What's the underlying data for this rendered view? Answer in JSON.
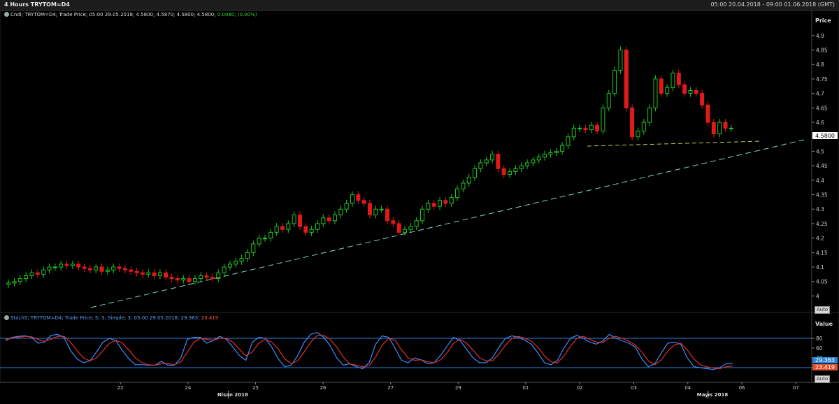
{
  "header": {
    "title": "4 Hours TRYTOM=D4",
    "range": "05:00 20.04.2018 - 09:00 01.06.2018 (GMT)"
  },
  "price_legend": {
    "text": "Cndl; TRYTOM=D4; Trade Price; 05:00 29.05.2018; 4.5800; 4.5870; 4.5800; 4.5800;",
    "change": "0.0080; (0.00%)"
  },
  "stoch_legend": {
    "text": "Stoch5; TRYTOM=D4; Trade Price;  5; 3; Simple; 3; 05:00 29.05.2018;",
    "k": "29.363;",
    "d": "23.419"
  },
  "auto_label": "Auto",
  "colors": {
    "up": "#1fc81f",
    "down": "#e01a1a",
    "stoch_k": "#3d8bff",
    "stoch_d": "#e0302a",
    "trend": "#7fd6c8",
    "support": "#c8c85a",
    "ref_lines": "#2a7fd6",
    "price_box_bg": "#ffffff",
    "k_box_bg": "#2a86d6",
    "d_box_bg": "#e0502a"
  },
  "chart_data": [
    {
      "type": "candlestick",
      "ylabel": "Price",
      "ylim": [
        3.96,
        4.96
      ],
      "y_ticks": [
        4,
        4.05,
        4.1,
        4.15,
        4.2,
        4.25,
        4.3,
        4.35,
        4.4,
        4.45,
        4.5,
        4.55,
        4.6,
        4.65,
        4.7,
        4.75,
        4.8,
        4.85,
        4.9
      ],
      "last_price": "4.5800",
      "last_value": 4.58,
      "closes": [
        4.045,
        4.05,
        4.06,
        4.07,
        4.08,
        4.075,
        4.09,
        4.1,
        4.1,
        4.11,
        4.105,
        4.11,
        4.1,
        4.095,
        4.09,
        4.1,
        4.085,
        4.09,
        4.1,
        4.095,
        4.09,
        4.085,
        4.08,
        4.075,
        4.08,
        4.07,
        4.08,
        4.065,
        4.06,
        4.055,
        4.06,
        4.05,
        4.06,
        4.07,
        4.065,
        4.06,
        4.08,
        4.1,
        4.11,
        4.12,
        4.13,
        4.15,
        4.18,
        4.2,
        4.2,
        4.22,
        4.24,
        4.23,
        4.25,
        4.28,
        4.24,
        4.22,
        4.23,
        4.25,
        4.27,
        4.26,
        4.28,
        4.3,
        4.32,
        4.35,
        4.33,
        4.32,
        4.28,
        4.3,
        4.3,
        4.26,
        4.25,
        4.22,
        4.23,
        4.24,
        4.26,
        4.3,
        4.32,
        4.31,
        4.33,
        4.32,
        4.34,
        4.37,
        4.39,
        4.41,
        4.44,
        4.46,
        4.47,
        4.49,
        4.44,
        4.42,
        4.43,
        4.44,
        4.45,
        4.46,
        4.47,
        4.48,
        4.49,
        4.495,
        4.5,
        4.52,
        4.55,
        4.58,
        4.58,
        4.575,
        4.59,
        4.57,
        4.65,
        4.7,
        4.78,
        4.85,
        4.65,
        4.55,
        4.57,
        4.6,
        4.65,
        4.75,
        4.7,
        4.72,
        4.77,
        4.73,
        4.7,
        4.71,
        4.7,
        4.66,
        4.6,
        4.56,
        4.6,
        4.58,
        4.58
      ],
      "x_range": [
        20.2,
        32.0
      ],
      "x_ticks": [
        {
          "label": "22",
          "x": 21.9
        },
        {
          "label": "24",
          "x": 22.9
        },
        {
          "label": "25",
          "x": 23.9
        },
        {
          "label": "26",
          "x": 24.9
        },
        {
          "label": "27",
          "x": 25.9
        },
        {
          "label": "29",
          "x": 26.9
        },
        {
          "label": "01",
          "x": 27.9
        },
        {
          "label": "02",
          "x": 28.7
        },
        {
          "label": "03",
          "x": 29.5
        },
        {
          "label": "04",
          "x": 30.3
        },
        {
          "label": "06",
          "x": 31.1
        },
        {
          "label": "07",
          "x": 31.9
        }
      ],
      "months": [
        {
          "label": "Nisan 2018",
          "x": 23.5
        },
        {
          "label": "Mayıs 2018",
          "x": 30.6
        }
      ]
    },
    {
      "type": "line",
      "ylabel": "Value",
      "ylim": [
        0,
        100
      ],
      "y_ticks": [
        20,
        40,
        60,
        80
      ],
      "ref_levels": [
        80,
        20
      ],
      "series": [
        {
          "name": "K",
          "values": [
            75,
            82,
            84,
            85,
            82,
            70,
            72,
            86,
            88,
            82,
            55,
            38,
            30,
            34,
            52,
            72,
            80,
            75,
            55,
            38,
            26,
            26,
            25,
            25,
            33,
            25,
            25,
            40,
            78,
            82,
            82,
            70,
            76,
            84,
            78,
            62,
            45,
            35,
            72,
            82,
            80,
            62,
            38,
            22,
            25,
            45,
            72,
            88,
            92,
            82,
            65,
            40,
            25,
            28,
            22,
            18,
            30,
            68,
            85,
            82,
            60,
            35,
            30,
            40,
            36,
            28,
            30,
            45,
            64,
            82,
            75,
            58,
            40,
            30,
            30,
            40,
            62,
            80,
            85,
            82,
            76,
            68,
            50,
            30,
            26,
            35,
            60,
            80,
            86,
            80,
            72,
            68,
            75,
            88,
            80,
            75,
            70,
            62,
            38,
            22,
            28,
            50,
            70,
            72,
            68,
            40,
            22,
            20,
            18,
            16,
            20,
            28,
            29.363
          ]
        },
        {
          "name": "D",
          "values": [
            78,
            80,
            82,
            84,
            83,
            78,
            74,
            78,
            84,
            84,
            72,
            55,
            40,
            34,
            40,
            55,
            70,
            76,
            70,
            56,
            40,
            30,
            26,
            25,
            28,
            28,
            26,
            32,
            52,
            72,
            80,
            78,
            76,
            80,
            80,
            72,
            58,
            44,
            52,
            70,
            78,
            72,
            58,
            38,
            28,
            34,
            52,
            72,
            86,
            86,
            78,
            62,
            42,
            28,
            25,
            22,
            24,
            42,
            66,
            80,
            76,
            56,
            40,
            35,
            36,
            32,
            30,
            36,
            50,
            70,
            78,
            70,
            56,
            40,
            34,
            34,
            48,
            66,
            80,
            84,
            80,
            74,
            62,
            44,
            32,
            30,
            44,
            64,
            80,
            84,
            78,
            72,
            72,
            80,
            84,
            80,
            74,
            66,
            52,
            34,
            26,
            36,
            54,
            66,
            70,
            56,
            38,
            26,
            22,
            19,
            18,
            22,
            23.419
          ]
        }
      ],
      "k_label": "29.363",
      "d_label": "23.419"
    }
  ]
}
